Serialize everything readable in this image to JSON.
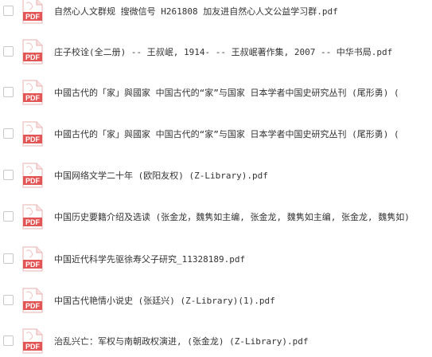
{
  "colors": {
    "pdf_red": "#e35454",
    "pdf_light": "#f4b3b3",
    "text": "#333333",
    "checkbox_border": "#c8c8c8"
  },
  "icon_name": "pdf-file-icon",
  "files": [
    {
      "name": "自然心人文群规 搜微信号 H261808 加友进自然心人文公益学习群.pdf",
      "icon_label": "PDF"
    },
    {
      "name": "庄子校诠(全二册) -- 王叔岷, 1914- -- 王叔岷著作集, 2007 -- 中华书局.pdf",
      "icon_label": "PDF"
    },
    {
      "name": "中國古代的「家」與國家 中国古代的“家”与国家 日本学者中国史研究丛刊 (尾形勇) (",
      "icon_label": "PDF"
    },
    {
      "name": "中國古代的「家」與國家 中国古代的“家”与国家 日本学者中国史研究丛刊 (尾形勇) (",
      "icon_label": "PDF"
    },
    {
      "name": "中国网络文学二十年 (欧阳友权) (Z-Library).pdf",
      "icon_label": "PDF"
    },
    {
      "name": "中国历史要籍介绍及选读 (张金龙，魏隽如主编, 张金龙, 魏隽如主编, 张金龙, 魏隽如)",
      "icon_label": "PDF"
    },
    {
      "name": "中国近代科学先驱徐寿父子研究_11328189.pdf",
      "icon_label": "PDF"
    },
    {
      "name": "中国古代艳情小说史 (张廷兴) (Z-Library)(1).pdf",
      "icon_label": "PDF"
    },
    {
      "name": "治乱兴亡：军权与南朝政权演进, (张金龙) (Z-Library).pdf",
      "icon_label": "PDF"
    }
  ]
}
